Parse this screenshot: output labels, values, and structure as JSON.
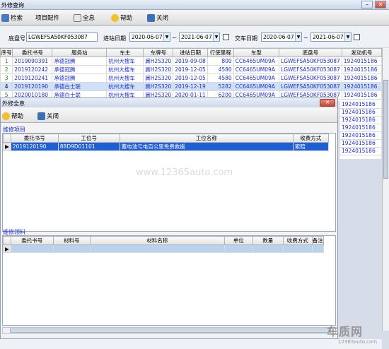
{
  "window": {
    "title": "外修查询",
    "min": "–",
    "close": "✕"
  },
  "toolbar": {
    "search": "检索",
    "parts": "项目配件",
    "preview": "全息",
    "help": "帮助",
    "close": "关闭"
  },
  "filter": {
    "chassis_label": "底盘号",
    "chassis_value": "LGWEFSA50KF053087",
    "entry_label": "进站日期",
    "entry_from": "2020-06-07",
    "entry_to": "2021-06-07",
    "tilde1": "~",
    "deliver_label": "交车日期",
    "deliver_from": "2020-06-07",
    "deliver_to": "2021-06-07",
    "tilde2": "~"
  },
  "main_table": {
    "headers": [
      "序号",
      "委托书号",
      "服务站",
      "车主",
      "车牌号",
      "进站日期",
      "行使里程",
      "车型",
      "底盘号",
      "发动机号"
    ],
    "rows": [
      [
        "1",
        "2019090391",
        "承德冠腾",
        "杭州大搜车",
        "冀H2S320",
        "2019-09-08",
        "800",
        "CC6465UM09A",
        "LGWEFSA50KF053087",
        "1924015186"
      ],
      [
        "2",
        "2019120242",
        "承德冠腾",
        "杭州大搜车",
        "冀H2S320",
        "2019-12-05",
        "4580",
        "CC6465UM09A",
        "LGWEFSA50KF053087",
        "1924015186"
      ],
      [
        "3",
        "2019120241",
        "承德冠腾",
        "杭州大搜车",
        "冀H2S320",
        "2019-12-05",
        "4580",
        "CC6465UM09A",
        "LGWEFSA50KF053087",
        "1924015186"
      ],
      [
        "4",
        "2019120190",
        "承德白士联",
        "杭州大搜车",
        "冀H2S320",
        "2019-12-19",
        "5282",
        "CC6465UM09A",
        "LGWEFSA50KF053087",
        "1924015186"
      ],
      [
        "5",
        "2020010180",
        "承德白士联",
        "杭州大搜车",
        "冀H2S320",
        "2020-01-11",
        "6200",
        "CC6465UM09A",
        "LGWEFSA50KF053087",
        "1924015186"
      ]
    ],
    "extra_engine": [
      "1924015186",
      "1924015186",
      "1924015186",
      "1924015186",
      "1924015186",
      "1924015186",
      "1924015186"
    ]
  },
  "dialog": {
    "title": "外修全息",
    "close": "✕",
    "help": "帮助",
    "close_btn": "关闭",
    "items_section": "维修项目",
    "items_headers": [
      "委托书号",
      "工位号",
      "工位名称",
      "收费方式"
    ],
    "items_rows": [
      [
        "2019120190",
        "88D9D01101",
        "蓄电池亏电百公里免费救援",
        "索赔"
      ]
    ],
    "materials_section": "维修领料",
    "materials_headers": [
      "委托书号",
      "材料号",
      "材料名称",
      "单位",
      "数量",
      "收费方式",
      "备注"
    ]
  },
  "watermark": "www.12365auto.com",
  "logo": {
    "big": "车质网",
    "url": "12365auto.com"
  },
  "colors": {
    "selected_row": "#1e5fd6",
    "link_blue": "#1a2fd0",
    "highlight_row": "#b9d2f0"
  }
}
